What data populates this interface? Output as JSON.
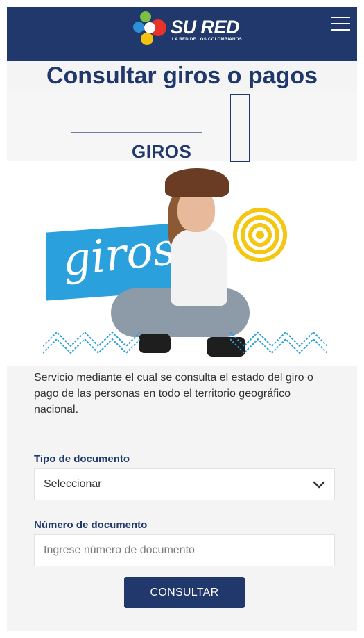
{
  "header": {
    "brand": "SU RED",
    "brand_tagline": "LA RED DE LOS COLOMBIANOS",
    "menu_icon": "hamburger-menu-icon"
  },
  "page": {
    "title": "Consultar giros o pagos"
  },
  "hero": {
    "heading": "GIROS",
    "script_word": "giros"
  },
  "description": "Servicio mediante el cual se consulta el estado del giro o pago de las personas en todo el territorio geográfico nacional.",
  "form": {
    "doc_type_label": "Tipo de documento",
    "doc_type_selected": "Seleccionar",
    "doc_number_label": "Número de documento",
    "doc_number_placeholder": "Ingrese número de documento",
    "doc_number_value": "",
    "submit_label": "CONSULTAR"
  },
  "colors": {
    "brand_navy": "#20386c",
    "accent_blue": "#2aa0dc",
    "accent_yellow": "#f3c712"
  }
}
